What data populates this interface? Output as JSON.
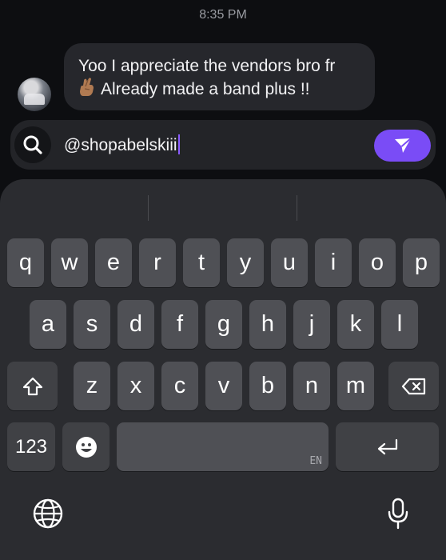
{
  "chat": {
    "timestamp": "8:35 PM",
    "message": {
      "line1": "Yoo I appreciate the vendors bro fr",
      "line2": "Already made a band plus !!",
      "emoji": "crossed-fingers"
    }
  },
  "composer": {
    "value": "@shopabelskiii",
    "search_icon": "search-icon",
    "send_icon": "send-icon",
    "accent": "#7a4cf6"
  },
  "keyboard": {
    "row1": [
      "q",
      "w",
      "e",
      "r",
      "t",
      "y",
      "u",
      "i",
      "o",
      "p"
    ],
    "row2": [
      "a",
      "s",
      "d",
      "f",
      "g",
      "h",
      "j",
      "k",
      "l"
    ],
    "row3": [
      "z",
      "x",
      "c",
      "v",
      "b",
      "n",
      "m"
    ],
    "numbers_label": "123",
    "space_hint": "EN",
    "icons": {
      "shift": "shift-icon",
      "backspace": "backspace-icon",
      "emoji": "emoji-icon",
      "return": "return-icon",
      "globe": "globe-icon",
      "mic": "microphone-icon"
    }
  }
}
